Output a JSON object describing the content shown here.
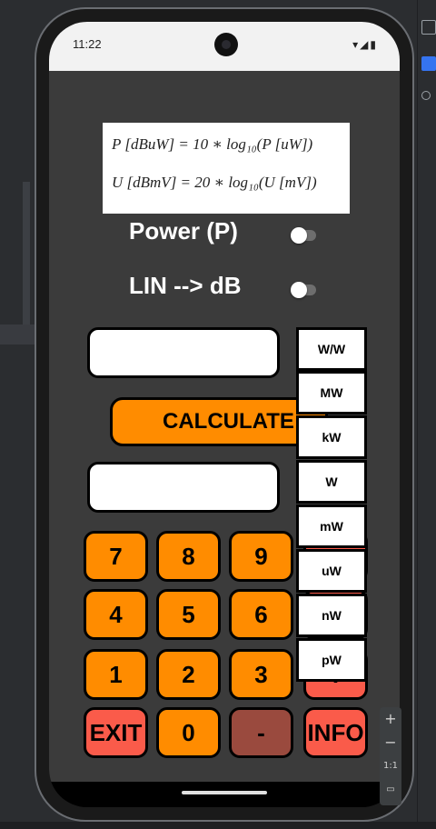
{
  "status": {
    "time": "11:22",
    "icons": "▾◢▮"
  },
  "formula": {
    "line1": "P  [dBuW]  =  10 ∗ log₁₀(P [uW])",
    "line2": "U  [dBmV]  =  20 ∗ log₁₀(U [mV])"
  },
  "toggles": [
    {
      "label": "Power (P)"
    },
    {
      "label": "LIN --> dB"
    }
  ],
  "calculate_label": "CALCULATE",
  "units": [
    "W/W",
    "MW",
    "kW",
    "W",
    "mW",
    "uW",
    "nW",
    "pW"
  ],
  "keys": {
    "k7": "7",
    "k8": "8",
    "k9": "9",
    "k4": "4",
    "k5": "5",
    "k6": "6",
    "k1": "1",
    "k2": "2",
    "k3": "3",
    "kdot": ".",
    "exit": "EXIT",
    "k0": "0",
    "minus": "-",
    "info": "INFO"
  },
  "zoom": {
    "plus": "+",
    "minus": "−",
    "ratio": "1:1"
  },
  "colors": {
    "accent": "#ff8c00",
    "danger": "#fa5b4a",
    "disabled": "#9a4a3e",
    "app_bg": "#3b3b3b"
  }
}
